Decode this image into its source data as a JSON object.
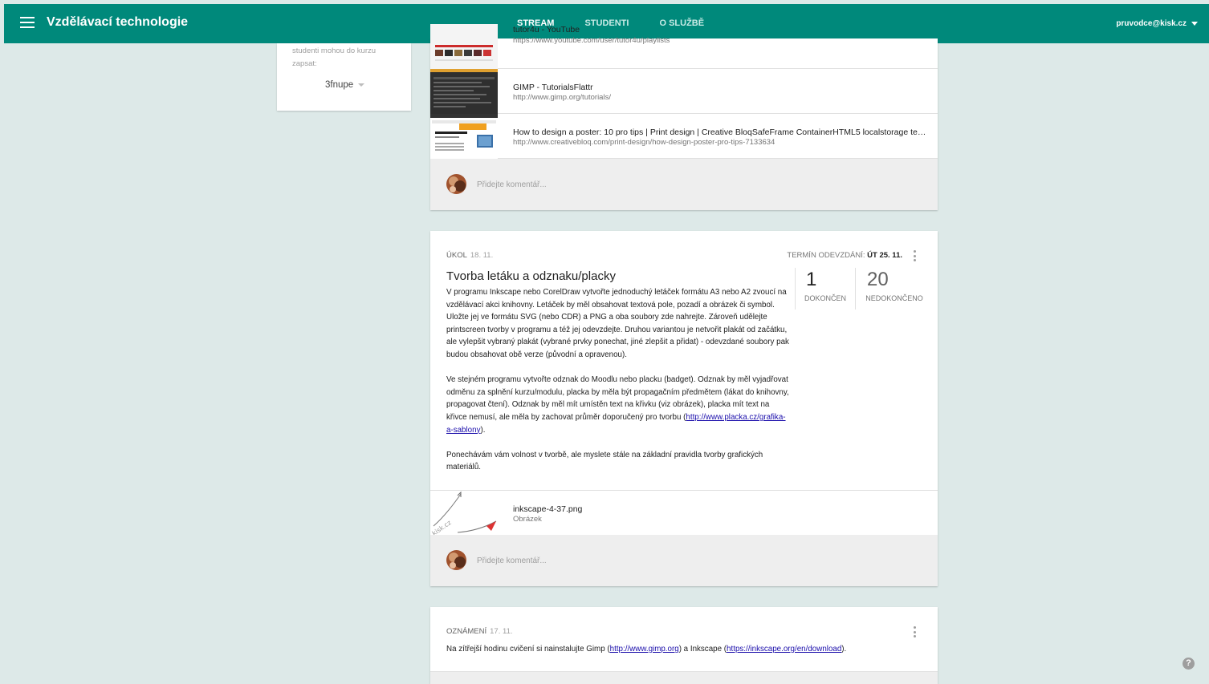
{
  "topbar": {
    "title": "Vzdělávací technologie",
    "tabs": [
      {
        "label": "STREAM"
      },
      {
        "label": "STUDENTI"
      },
      {
        "label": "O SLUŽBĚ"
      }
    ],
    "account": "pruvodce@kisk.cz",
    "color": "#00897b"
  },
  "sidebar": {
    "text": "studenti mohou do kurzu zapsat:",
    "class_code": "3fnupe"
  },
  "post1": {
    "links": [
      {
        "title": "tutor4u - YouTube",
        "url": "https://www.youtube.com/user/tutor4u/playlists"
      },
      {
        "title": "GIMP - TutorialsFlattr",
        "url": "http://www.gimp.org/tutorials/"
      },
      {
        "title": "How to design a poster: 10 pro tips | Print design | Creative BloqSafeFrame ContainerHTML5 localstorage tes...",
        "url": "http://www.creativebloq.com/print-design/how-design-poster-pro-tips-7133634"
      }
    ],
    "comment_placeholder": "Přidejte komentář..."
  },
  "post2": {
    "type": "ÚKOL",
    "date": "18. 11.",
    "deadline_label": "TERMÍN ODEVZDÁNÍ:",
    "deadline_value": "ÚT 25. 11.",
    "title": "Tvorba letáku a odznaku/placky",
    "para1": "V programu Inkscape nebo CorelDraw vytvořte jednoduchý letáček formátu A3 nebo A2 zvoucí na vzdělávací akci knihovny. Letáček by měl obsahovat textová pole, pozadí a obrázek či symbol. Uložte jej ve formátu SVG (nebo CDR) a PNG a oba soubory zde nahrejte. Zároveň udělejte printscreen tvorby v programu a též jej odevzdejte. Druhou variantou je netvořit plakát od začátku, ale vylepšit vybraný plakát (vybrané prvky ponechat, jiné zlepšit a přidat) - odevzdané soubory pak budou obsahovat obě verze (původní a opravenou).",
    "para2_before": "Ve stejném programu vytvořte odznak do Moodlu nebo placku (badget). Odznak by měl vyjadřovat odměnu za splnění kurzu/modulu, placka by měla být propagačním předmětem (lákat do knihovny, propagovat čtení). Odznak by měl mít umístěn text na křivku (viz obrázek), placka mít text na křivce nemusí, ale měla by zachovat průměr doporučený pro tvorbu (",
    "para2_link": "http://www.placka.cz/grafika-a-sablony",
    "para2_after": ").",
    "para3": "Ponechávám vám volnost v tvorbě, ale myslete stále na základní pravidla tvorby grafických materiálů.",
    "stats": [
      {
        "value": "1",
        "label": "DOKONČEN"
      },
      {
        "value": "20",
        "label": "NEDOKONČENO"
      }
    ],
    "attachment": {
      "name": "inkscape-4-37.png",
      "type": "Obrázek"
    },
    "comment_placeholder": "Přidejte komentář..."
  },
  "post3": {
    "type": "OZNÁMENÍ",
    "date": "17. 11.",
    "text_1": "Na zítřejší hodinu cvičení si nainstalujte Gimp (",
    "link_1": "http://www.gimp.org",
    "text_2": ") a Inkscape (",
    "link_2": "https://inkscape.org/en/download",
    "text_3": ")."
  },
  "help_icon": "?"
}
